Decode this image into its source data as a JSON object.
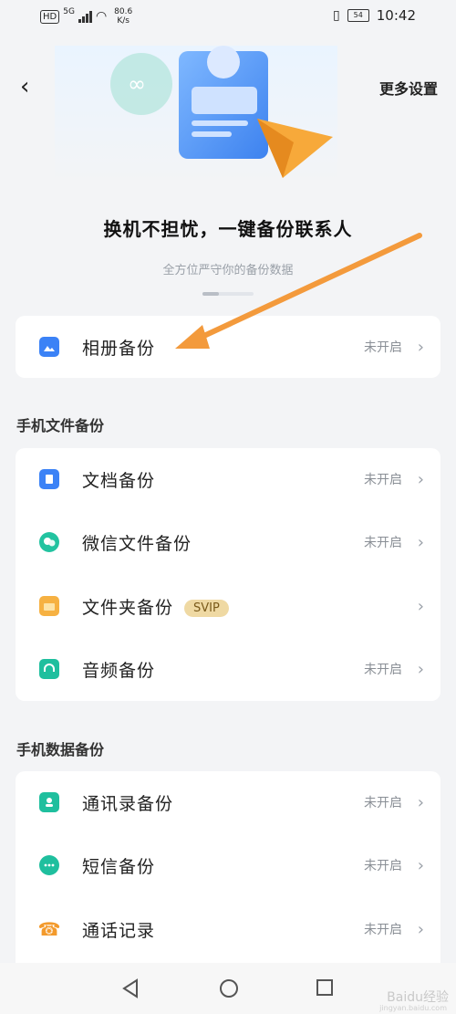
{
  "status": {
    "hd": "HD",
    "net": "5G",
    "speed": "80.6",
    "speed_unit": "K/s",
    "battery": "54",
    "time": "10:42"
  },
  "header": {
    "back_icon": "back-chevron-icon",
    "more": "更多设置"
  },
  "hero": {
    "slogan": "换机不担忧，一键备份联系人",
    "subtitle": "全方位严守你的备份数据",
    "carousel_active": 1,
    "carousel_total": 3
  },
  "album": {
    "label": "相册备份",
    "status": "未开启",
    "icon": "album-icon",
    "color": "#3b82f6"
  },
  "file_section": {
    "title": "手机文件备份",
    "items": [
      {
        "label": "文档备份",
        "status": "未开启",
        "icon": "document-icon",
        "color": "#3b82f6"
      },
      {
        "label": "微信文件备份",
        "status": "未开启",
        "icon": "wechat-icon",
        "color": "#22c3a0"
      },
      {
        "label": "文件夹备份",
        "badge": "SVIP",
        "status": "",
        "icon": "folder-icon",
        "color": "#f6b142"
      },
      {
        "label": "音频备份",
        "status": "未开启",
        "icon": "headphones-icon",
        "color": "#1fbf9e"
      }
    ]
  },
  "data_section": {
    "title": "手机数据备份",
    "items": [
      {
        "label": "通讯录备份",
        "status": "未开启",
        "icon": "contacts-icon",
        "color": "#1fbf9e"
      },
      {
        "label": "短信备份",
        "status": "未开启",
        "icon": "sms-icon",
        "color": "#1fbf9e"
      },
      {
        "label": "通话记录",
        "status": "未开启",
        "icon": "phone-icon",
        "color": "#f39a2c"
      }
    ]
  },
  "navbar": {
    "back": "nav-back-icon",
    "home": "nav-home-icon",
    "recent": "nav-recent-icon"
  },
  "watermark": {
    "text": "Baidu经验",
    "url": "jingyan.baidu.com"
  }
}
